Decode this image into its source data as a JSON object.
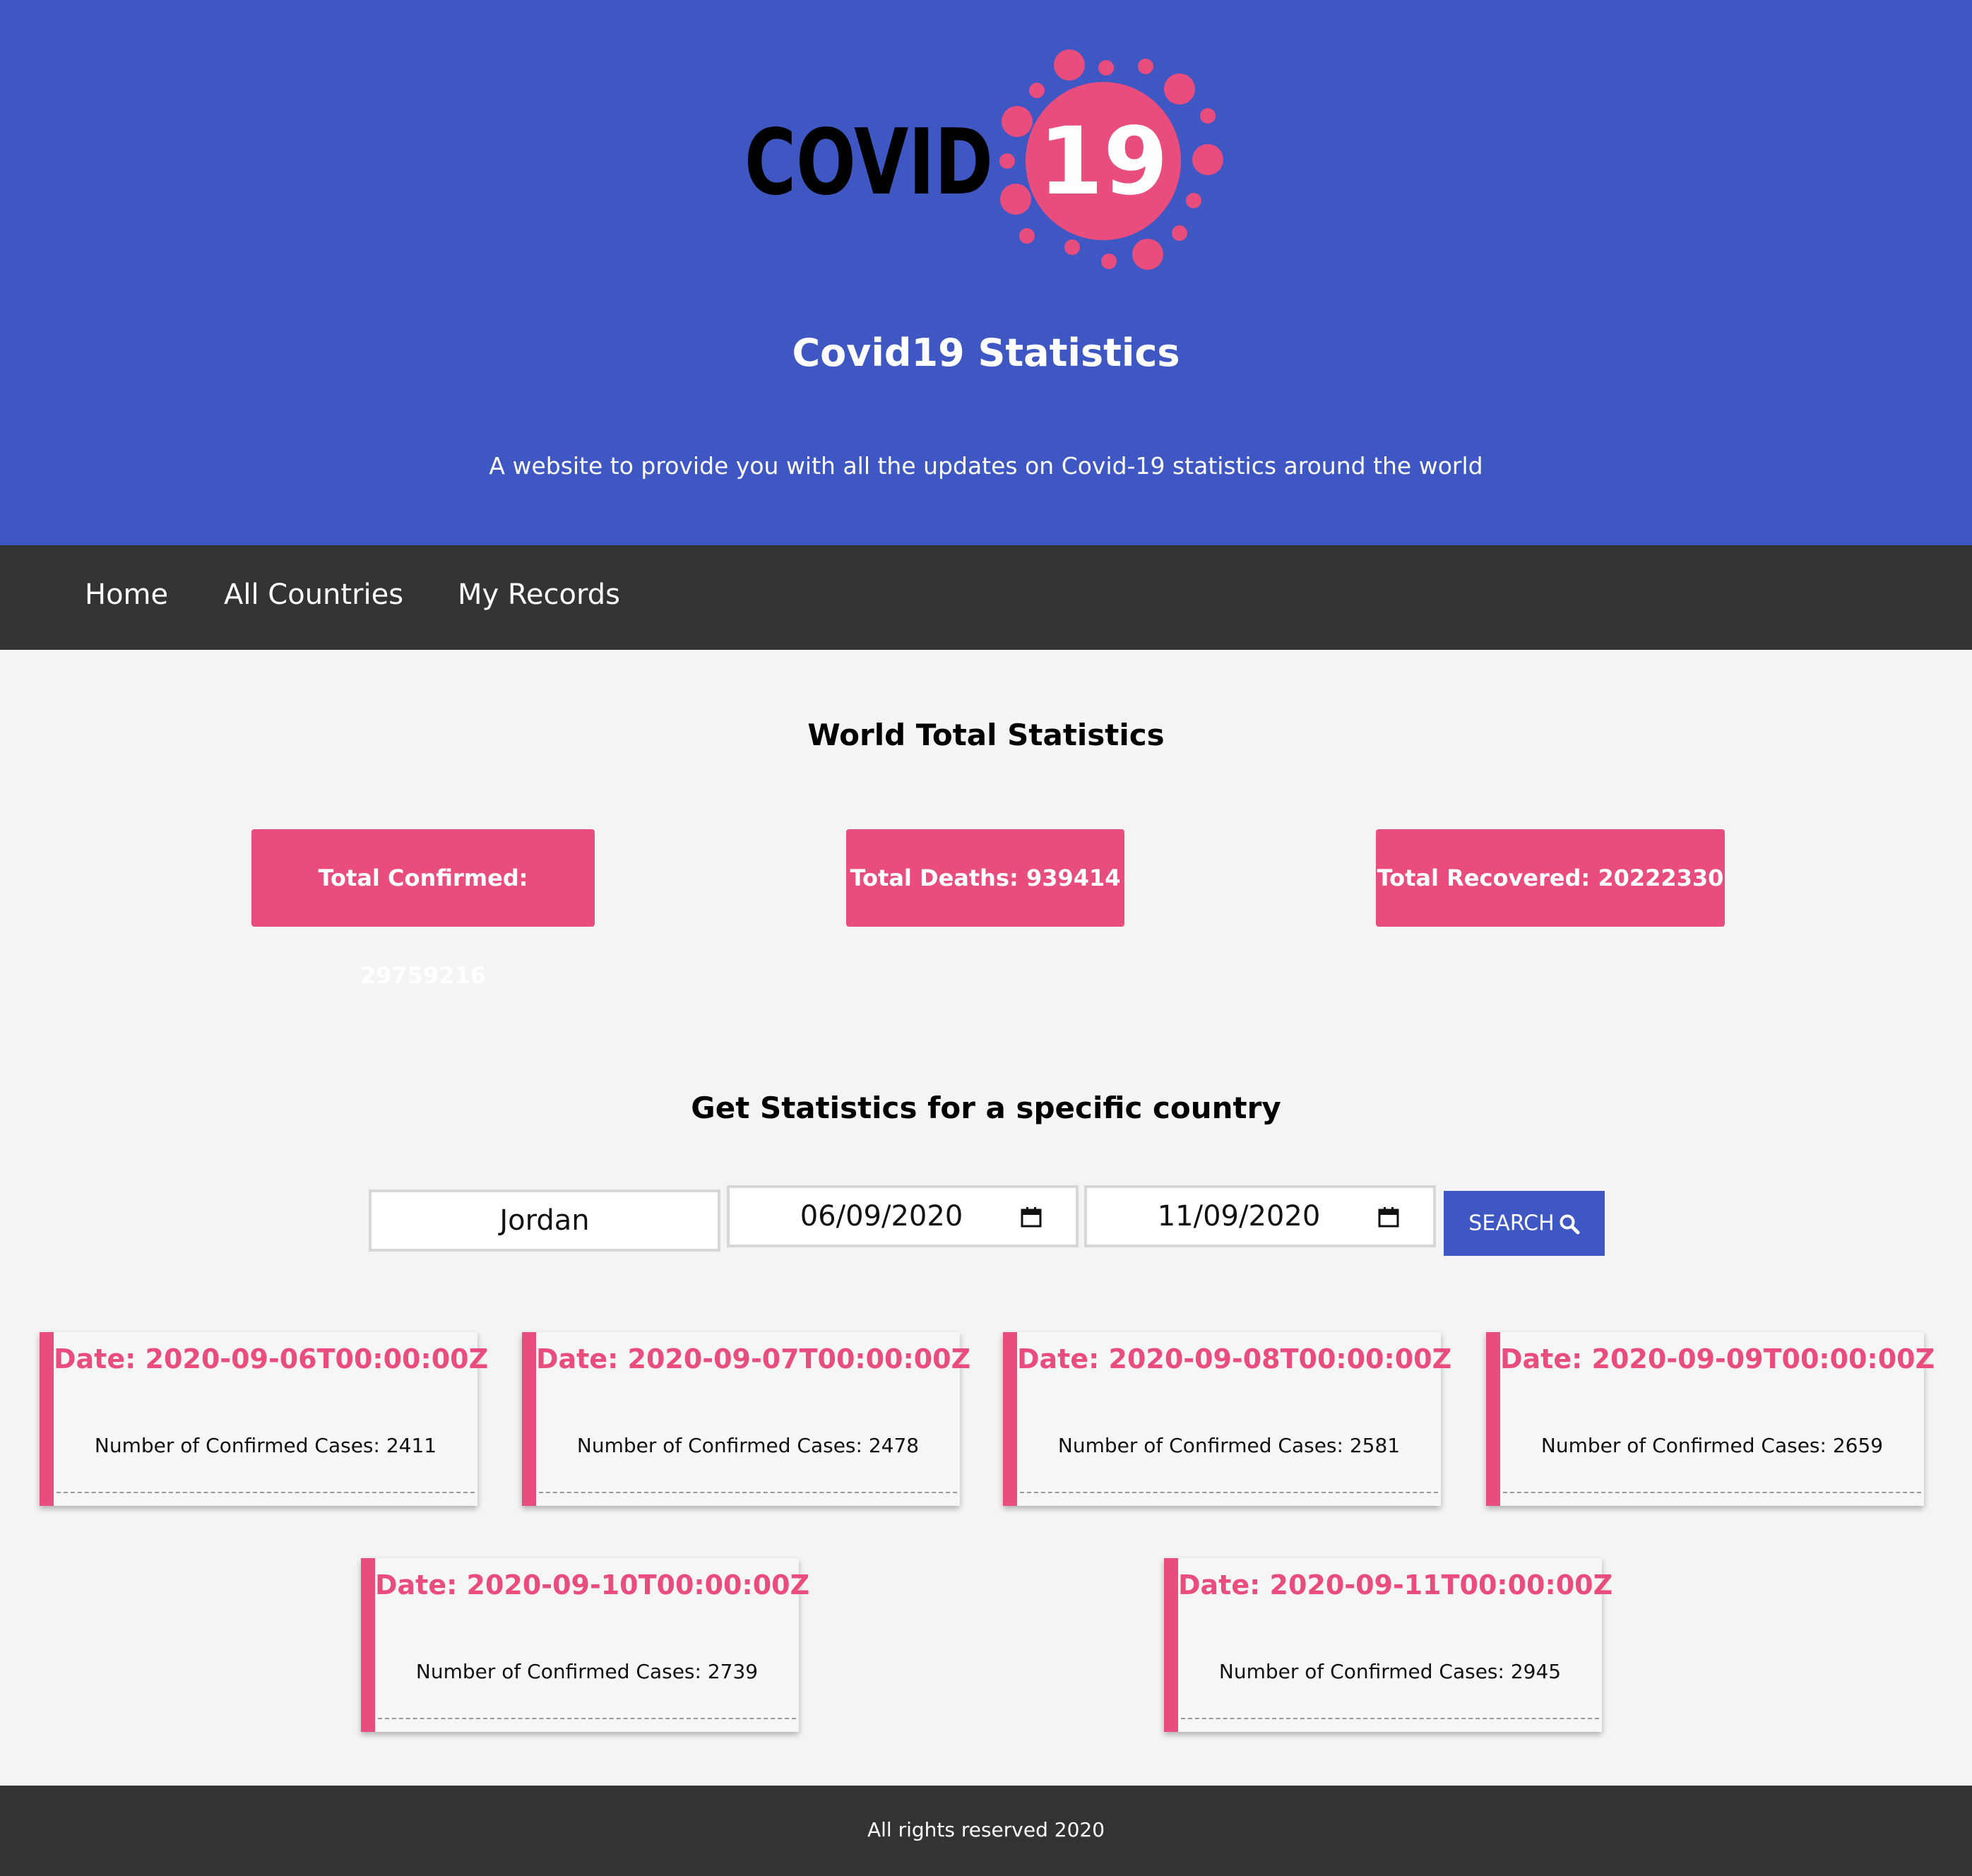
{
  "header": {
    "logo_word": "COVID",
    "logo_number": "19",
    "title": "Covid19 Statistics",
    "subtitle": "A website to provide you with all the updates on Covid-19 statistics around the world"
  },
  "nav": {
    "items": [
      {
        "label": "Home"
      },
      {
        "label": "All Countries"
      },
      {
        "label": "My Records"
      }
    ]
  },
  "world": {
    "heading": "World Total Statistics",
    "confirmed": "Total Confirmed: 29759216",
    "deaths": "Total Deaths: 939414",
    "recovered": "Total Recovered: 20222330"
  },
  "search": {
    "heading": "Get Statistics for a specific country",
    "country_value": "Jordan",
    "from_date": "06/09/2020",
    "to_date": "11/09/2020",
    "button_label": "SEARCH"
  },
  "results": [
    {
      "date": "Date: 2020-09-06T00:00:00Z",
      "cases": "Number of Confirmed Cases: 2411"
    },
    {
      "date": "Date: 2020-09-07T00:00:00Z",
      "cases": "Number of Confirmed Cases: 2478"
    },
    {
      "date": "Date: 2020-09-08T00:00:00Z",
      "cases": "Number of Confirmed Cases: 2581"
    },
    {
      "date": "Date: 2020-09-09T00:00:00Z",
      "cases": "Number of Confirmed Cases: 2659"
    },
    {
      "date": "Date: 2020-09-10T00:00:00Z",
      "cases": "Number of Confirmed Cases: 2739"
    },
    {
      "date": "Date: 2020-09-11T00:00:00Z",
      "cases": "Number of Confirmed Cases: 2945"
    }
  ],
  "footer": {
    "text": "All rights reserved 2020"
  },
  "colors": {
    "brand_blue": "#3f57c2",
    "accent_pink": "#e84d7e",
    "dark": "#333333",
    "background": "#f4f4f4"
  }
}
